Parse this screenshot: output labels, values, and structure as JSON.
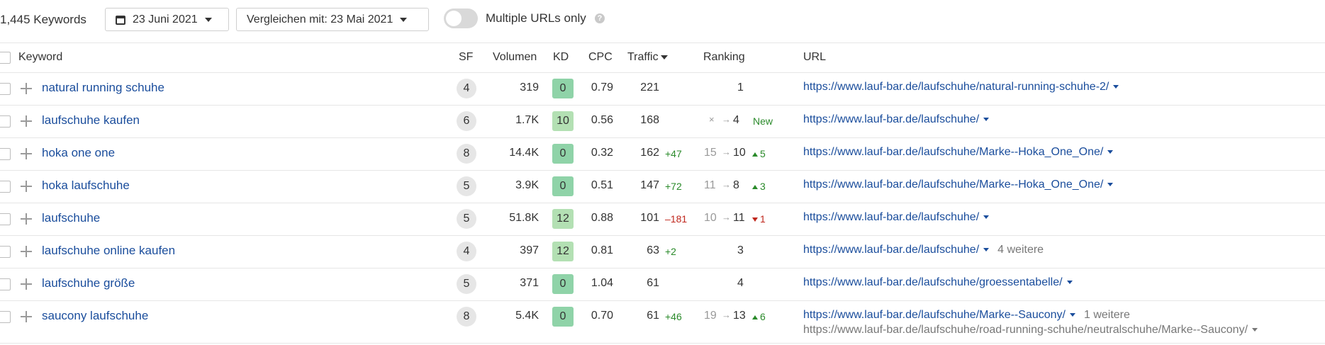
{
  "toolbar": {
    "keyword_count": "1,445 Keywords",
    "date": "23 Juni 2021",
    "compare": "Vergleichen mit: 23 Mai 2021",
    "toggle_label": "Multiple URLs only",
    "help": "?",
    "toggle_on": false
  },
  "columns": {
    "keyword": "Keyword",
    "sf": "SF",
    "volume": "Volumen",
    "kd": "KD",
    "cpc": "CPC",
    "traffic": "Traffic",
    "ranking": "Ranking",
    "url": "URL"
  },
  "colors": {
    "link": "#1a4d9c",
    "kd_dark": "#8fd3a8",
    "kd_light": "#b3e0b3",
    "positive": "#2a8a2a",
    "negative": "#c0271d"
  },
  "rows": [
    {
      "keyword": "natural running schuhe",
      "sf": "4",
      "volume": "319",
      "kd": "0",
      "kd_shade": "dark",
      "cpc": "0.79",
      "traffic": "221",
      "traffic_change": "",
      "traffic_dir": "",
      "rank_from": "",
      "rank_arrow": "",
      "rank_to": "1",
      "rank_delta": "",
      "rank_dir": "",
      "url": "https://www.lauf-bar.de/laufschuhe/natural-running-schuhe-2/",
      "more": "",
      "url2": ""
    },
    {
      "keyword": "laufschuhe kaufen",
      "sf": "6",
      "volume": "1.7K",
      "kd": "10",
      "kd_shade": "light",
      "cpc": "0.56",
      "traffic": "168",
      "traffic_change": "",
      "traffic_dir": "",
      "rank_from": "×",
      "rank_arrow": "→",
      "rank_to": "4",
      "rank_delta": "New",
      "rank_dir": "new",
      "url": "https://www.lauf-bar.de/laufschuhe/",
      "more": "",
      "url2": ""
    },
    {
      "keyword": "hoka one one",
      "sf": "8",
      "volume": "14.4K",
      "kd": "0",
      "kd_shade": "dark",
      "cpc": "0.32",
      "traffic": "162",
      "traffic_change": "+47",
      "traffic_dir": "pos",
      "rank_from": "15",
      "rank_arrow": "→",
      "rank_to": "10",
      "rank_delta": "5",
      "rank_dir": "up",
      "url": "https://www.lauf-bar.de/laufschuhe/Marke--Hoka_One_One/",
      "more": "",
      "url2": ""
    },
    {
      "keyword": "hoka laufschuhe",
      "sf": "5",
      "volume": "3.9K",
      "kd": "0",
      "kd_shade": "dark",
      "cpc": "0.51",
      "traffic": "147",
      "traffic_change": "+72",
      "traffic_dir": "pos",
      "rank_from": "11",
      "rank_arrow": "→",
      "rank_to": "8",
      "rank_delta": "3",
      "rank_dir": "up",
      "url": "https://www.lauf-bar.de/laufschuhe/Marke--Hoka_One_One/",
      "more": "",
      "url2": ""
    },
    {
      "keyword": "laufschuhe",
      "sf": "5",
      "volume": "51.8K",
      "kd": "12",
      "kd_shade": "light",
      "cpc": "0.88",
      "traffic": "101",
      "traffic_change": "–181",
      "traffic_dir": "neg",
      "rank_from": "10",
      "rank_arrow": "→",
      "rank_to": "11",
      "rank_delta": "1",
      "rank_dir": "down",
      "url": "https://www.lauf-bar.de/laufschuhe/",
      "more": "",
      "url2": ""
    },
    {
      "keyword": "laufschuhe online kaufen",
      "sf": "4",
      "volume": "397",
      "kd": "12",
      "kd_shade": "light",
      "cpc": "0.81",
      "traffic": "63",
      "traffic_change": "+2",
      "traffic_dir": "pos",
      "rank_from": "",
      "rank_arrow": "",
      "rank_to": "3",
      "rank_delta": "",
      "rank_dir": "",
      "url": "https://www.lauf-bar.de/laufschuhe/",
      "more": "4 weitere",
      "url2": ""
    },
    {
      "keyword": "laufschuhe größe",
      "sf": "5",
      "volume": "371",
      "kd": "0",
      "kd_shade": "dark",
      "cpc": "1.04",
      "traffic": "61",
      "traffic_change": "",
      "traffic_dir": "",
      "rank_from": "",
      "rank_arrow": "",
      "rank_to": "4",
      "rank_delta": "",
      "rank_dir": "",
      "url": "https://www.lauf-bar.de/laufschuhe/groessentabelle/",
      "more": "",
      "url2": ""
    },
    {
      "keyword": "saucony laufschuhe",
      "sf": "8",
      "volume": "5.4K",
      "kd": "0",
      "kd_shade": "dark",
      "cpc": "0.70",
      "traffic": "61",
      "traffic_change": "+46",
      "traffic_dir": "pos",
      "rank_from": "19",
      "rank_arrow": "→",
      "rank_to": "13",
      "rank_delta": "6",
      "rank_dir": "up",
      "url": "https://www.lauf-bar.de/laufschuhe/Marke--Saucony/",
      "more": "1 weitere",
      "url2": "https://www.lauf-bar.de/laufschuhe/road-running-schuhe/neutralschuhe/Marke--Saucony/"
    }
  ]
}
